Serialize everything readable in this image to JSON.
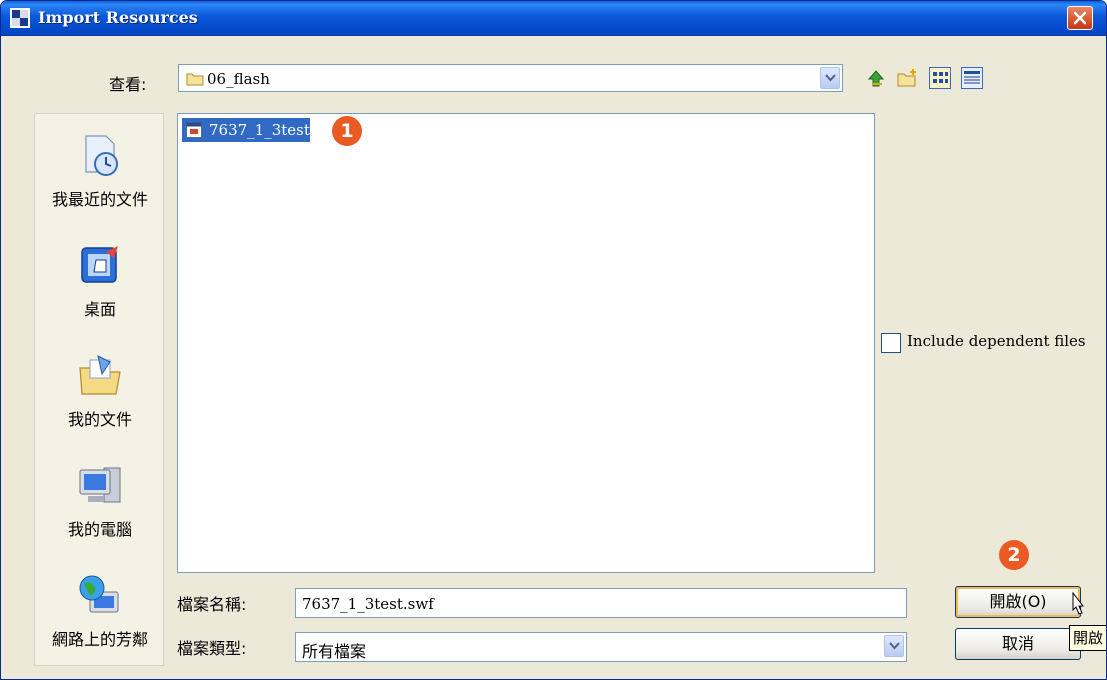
{
  "window": {
    "title": "Import Resources"
  },
  "look_in": {
    "label": "查看:",
    "value": "06_flash"
  },
  "places": [
    {
      "label": "我最近的文件",
      "icon": "recent-documents-icon"
    },
    {
      "label": "桌面",
      "icon": "desktop-icon"
    },
    {
      "label": "我的文件",
      "icon": "my-documents-icon"
    },
    {
      "label": "我的電腦",
      "icon": "my-computer-icon"
    },
    {
      "label": "網路上的芳鄰",
      "icon": "network-places-icon"
    }
  ],
  "files": [
    {
      "name": "7637_1_3test",
      "selected": true
    }
  ],
  "callouts": {
    "first": "1",
    "second": "2"
  },
  "include_dependent": {
    "label": "Include dependent files",
    "checked": false
  },
  "file_name": {
    "label": "檔案名稱:",
    "value": "7637_1_3test.swf"
  },
  "file_type": {
    "label": "檔案類型:",
    "value": "所有檔案"
  },
  "buttons": {
    "open": "開啟(O)",
    "cancel": "取消"
  },
  "tooltip": "開啟",
  "colors": {
    "titlebar": "#0a58da",
    "selection": "#316ac5",
    "callout": "#ec5a24",
    "dialog_bg": "#ece9d8"
  }
}
